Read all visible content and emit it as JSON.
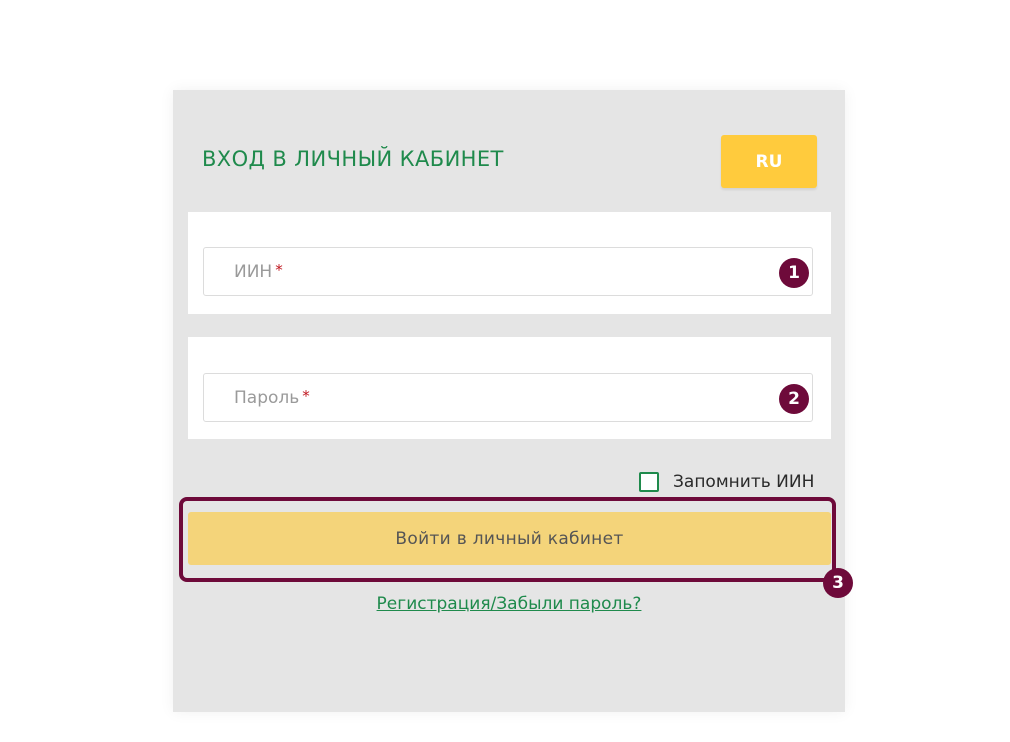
{
  "login_card": {
    "title": "ВХОД В ЛИЧНЫЙ КАБИНЕТ",
    "language_button": "RU",
    "iin_field": {
      "placeholder": "ИИН",
      "required_mark": "*",
      "marker": "1"
    },
    "password_field": {
      "placeholder": "Пароль",
      "required_mark": "*",
      "marker": "2"
    },
    "remember": {
      "label": "Запомнить ИИН",
      "checked": false
    },
    "login_button": {
      "label": "Войти в личный кабинет",
      "marker": "3"
    },
    "register_link": "Регистрация/Забыли пароль?"
  },
  "colors": {
    "accent_green": "#1f8a4c",
    "yellow": "#ffcb3d",
    "login_yellow": "#f4d47a",
    "marker_maroon": "#6e0a3a",
    "card_bg": "#e5e5e5"
  }
}
